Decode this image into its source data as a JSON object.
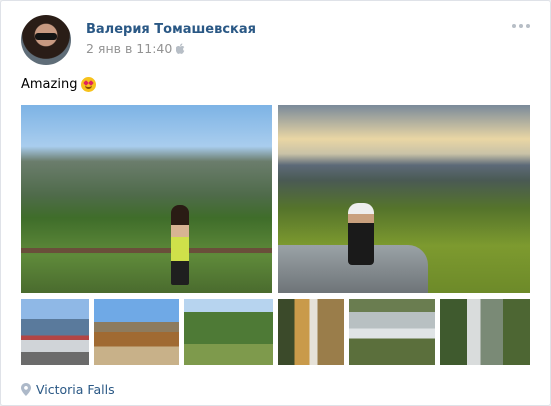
{
  "post": {
    "author": "Валерия Томашевская",
    "date": "2 янв в 11:40",
    "text": "Amazing",
    "emoji_icon": "heart-eyes-emoji-icon",
    "device_icon": "apple-icon",
    "location": "Victoria Falls",
    "location_icon": "pin-icon"
  },
  "colors": {
    "link": "#2a5885",
    "meta": "#939393",
    "background": "#edeef0",
    "card": "#ffffff"
  }
}
